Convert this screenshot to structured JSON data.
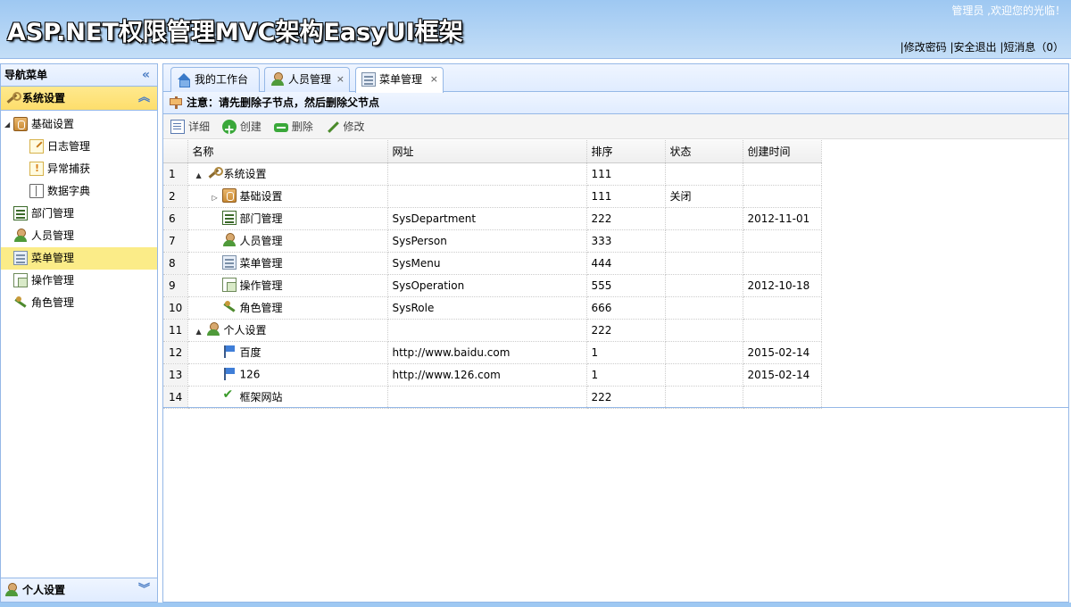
{
  "header": {
    "title": "ASP.NET权限管理MVC架构EasyUI框架",
    "welcome": "管理员 ,欢迎您的光临！",
    "links": [
      "|修改密码",
      "|安全退出",
      "|短消息（0）"
    ]
  },
  "west": {
    "title": "导航菜单",
    "accordion": [
      {
        "label": "系统设置",
        "active": true
      },
      {
        "label": "个人设置",
        "active": false
      }
    ],
    "tree": [
      {
        "label": "基础设置",
        "icon": "book-icon",
        "expanded": true
      },
      {
        "label": "日志管理",
        "icon": "log-icon"
      },
      {
        "label": "异常捕获",
        "icon": "warning-icon"
      },
      {
        "label": "数据字典",
        "icon": "dictionary-icon"
      },
      {
        "label": "部门管理",
        "icon": "department-icon"
      },
      {
        "label": "人员管理",
        "icon": "person-icon"
      },
      {
        "label": "菜单管理",
        "icon": "menu-icon",
        "selected": true
      },
      {
        "label": "操作管理",
        "icon": "operation-icon"
      },
      {
        "label": "角色管理",
        "icon": "role-icon"
      }
    ]
  },
  "tabs": [
    {
      "label": "我的工作台",
      "icon": "home-icon",
      "closable": false
    },
    {
      "label": "人员管理",
      "icon": "person-icon",
      "closable": true
    },
    {
      "label": "菜单管理",
      "icon": "menu-icon",
      "closable": true,
      "active": true
    }
  ],
  "tab_close": "×",
  "notice": "注意：请先删除子节点，然后删除父节点",
  "toolbar": [
    "详细",
    "创建",
    "删除",
    "修改"
  ],
  "grid": {
    "columns": [
      "名称",
      "网址",
      "排序",
      "状态",
      "创建时间"
    ],
    "rows": [
      {
        "rownum": "1",
        "name": "系统设置",
        "url": "",
        "sort": "111",
        "status": "",
        "created": "",
        "level": 0,
        "toggle": "▲",
        "icon": "wrench-icon"
      },
      {
        "rownum": "2",
        "name": "基础设置",
        "url": "",
        "sort": "111",
        "status": "关闭",
        "created": "",
        "level": 1,
        "toggle": "▷",
        "icon": "book-icon"
      },
      {
        "rownum": "6",
        "name": "部门管理",
        "url": "SysDepartment",
        "sort": "222",
        "status": "",
        "created": "2012-11-01",
        "level": 1,
        "toggle": "",
        "icon": "department-icon"
      },
      {
        "rownum": "7",
        "name": "人员管理",
        "url": "SysPerson",
        "sort": "333",
        "status": "",
        "created": "",
        "level": 1,
        "toggle": "",
        "icon": "person-icon"
      },
      {
        "rownum": "8",
        "name": "菜单管理",
        "url": "SysMenu",
        "sort": "444",
        "status": "",
        "created": "",
        "level": 1,
        "toggle": "",
        "icon": "menu-icon"
      },
      {
        "rownum": "9",
        "name": "操作管理",
        "url": "SysOperation",
        "sort": "555",
        "status": "",
        "created": "2012-10-18",
        "level": 1,
        "toggle": "",
        "icon": "operation-icon"
      },
      {
        "rownum": "10",
        "name": "角色管理",
        "url": "SysRole",
        "sort": "666",
        "status": "",
        "created": "",
        "level": 1,
        "toggle": "",
        "icon": "role-icon"
      },
      {
        "rownum": "11",
        "name": "个人设置",
        "url": "",
        "sort": "222",
        "status": "",
        "created": "",
        "level": 0,
        "toggle": "▲",
        "icon": "person-icon"
      },
      {
        "rownum": "12",
        "name": "百度",
        "url": "http://www.baidu.com",
        "sort": "1",
        "status": "",
        "created": "2015-02-14",
        "level": 1,
        "toggle": "",
        "icon": "flag-icon"
      },
      {
        "rownum": "13",
        "name": "126",
        "url": "http://www.126.com",
        "sort": "1",
        "status": "",
        "created": "2015-02-14",
        "level": 1,
        "toggle": "",
        "icon": "flag-icon"
      },
      {
        "rownum": "14",
        "name": "框架网站",
        "url": "",
        "sort": "222",
        "status": "",
        "created": "",
        "level": 1,
        "toggle": "",
        "icon": "check-icon"
      }
    ]
  }
}
